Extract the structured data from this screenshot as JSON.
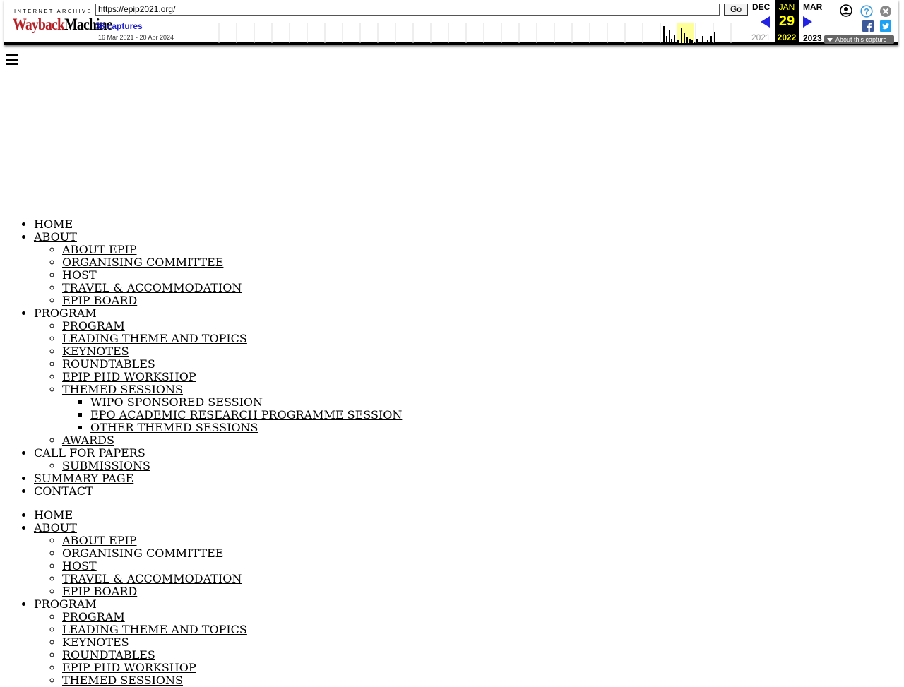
{
  "toolbar": {
    "logo_top": "INTERNET ARCHIVE",
    "logo_main_a": "Wayback",
    "logo_main_b": "Machine",
    "url": "https://epip2021.org/",
    "go_label": "Go",
    "captures_label": "38 captures",
    "date_range": "16 Mar 2021 - 20 Apr 2024",
    "prev_month": "DEC",
    "prev_year": "2021",
    "current_month": "JAN",
    "current_day": "29",
    "current_year": "2022",
    "next_month": "MAR",
    "next_year": "2023",
    "about_label": "About this capture",
    "icons": [
      "user-icon",
      "help-icon",
      "close-icon",
      "facebook-icon",
      "twitter-icon"
    ],
    "colors": {
      "accent": "#2323e3",
      "current_bg": "#000000",
      "current_fg": "#ffff00",
      "logo_red": "#b52026"
    }
  },
  "menus": [
    {
      "items": [
        {
          "label": "HOME"
        },
        {
          "label": "ABOUT",
          "children": [
            {
              "label": "ABOUT EPIP"
            },
            {
              "label": "ORGANISING COMMITTEE"
            },
            {
              "label": "HOST"
            },
            {
              "label": "TRAVEL & ACCOMMODATION"
            },
            {
              "label": "EPIP BOARD"
            }
          ]
        },
        {
          "label": "PROGRAM",
          "children": [
            {
              "label": "PROGRAM"
            },
            {
              "label": "LEADING THEME AND TOPICS"
            },
            {
              "label": "KEYNOTES"
            },
            {
              "label": "ROUNDTABLES"
            },
            {
              "label": "EPIP PHD WORKSHOP"
            },
            {
              "label": "THEMED SESSIONS",
              "children": [
                {
                  "label": "WIPO SPONSORED SESSION"
                },
                {
                  "label": "EPO ACADEMIC RESEARCH PROGRAMME SESSION"
                },
                {
                  "label": "OTHER THEMED SESSIONS"
                }
              ]
            },
            {
              "label": "AWARDS"
            }
          ]
        },
        {
          "label": "CALL FOR PAPERS",
          "children": [
            {
              "label": "SUBMISSIONS"
            }
          ]
        },
        {
          "label": "SUMMARY PAGE"
        },
        {
          "label": "CONTACT"
        }
      ]
    },
    {
      "items": [
        {
          "label": "HOME"
        },
        {
          "label": "ABOUT",
          "children": [
            {
              "label": "ABOUT EPIP"
            },
            {
              "label": "ORGANISING COMMITTEE"
            },
            {
              "label": "HOST"
            },
            {
              "label": "TRAVEL & ACCOMMODATION"
            },
            {
              "label": "EPIP BOARD"
            }
          ]
        },
        {
          "label": "PROGRAM",
          "children": [
            {
              "label": "PROGRAM"
            },
            {
              "label": "LEADING THEME AND TOPICS"
            },
            {
              "label": "KEYNOTES"
            },
            {
              "label": "ROUNDTABLES"
            },
            {
              "label": "EPIP PHD WORKSHOP"
            },
            {
              "label": "THEMED SESSIONS"
            }
          ]
        }
      ]
    }
  ]
}
